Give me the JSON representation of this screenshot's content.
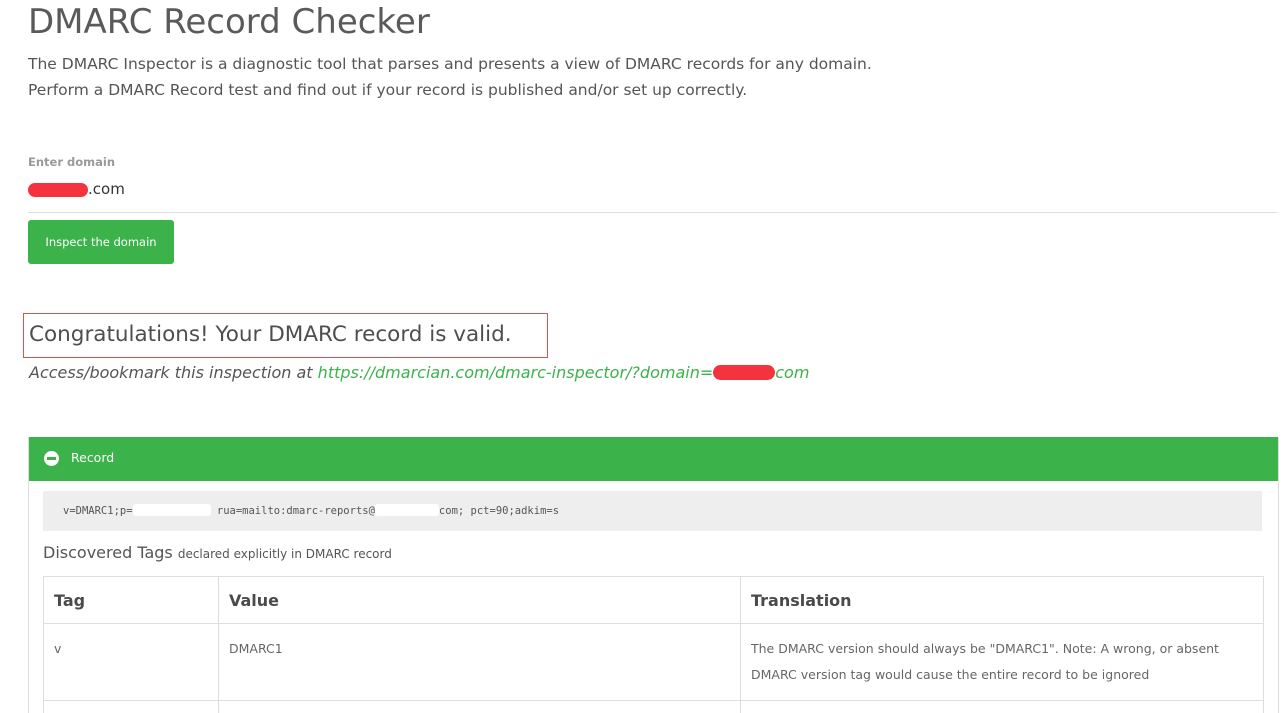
{
  "header": {
    "title": "DMARC Record Checker",
    "description_line1": "The DMARC Inspector is a diagnostic tool that parses and presents a view of DMARC records for any domain.",
    "description_line2": "Perform a DMARC Record test and find out if your record is published and/or set up correctly."
  },
  "form": {
    "domain_label": "Enter domain",
    "domain_value_visible": ".com",
    "inspect_button_label": "Inspect the domain"
  },
  "result": {
    "congrats_text": "Congratulations! Your DMARC record is valid.",
    "access_prefix": "Access/bookmark this inspection at ",
    "access_link_text": "https://dmarcian.com/dmarc-inspector/?domain=",
    "access_link_suffix": "com"
  },
  "record_panel": {
    "title": "Record",
    "record_part1": "v=DMARC1;p=",
    "record_part2": "rua=mailto:dmarc-reports@",
    "record_part3": "com; pct=90;adkim=s"
  },
  "discovered": {
    "heading": "Discovered Tags",
    "subheading": "declared explicitly in DMARC record"
  },
  "table": {
    "headers": [
      "Tag",
      "Value",
      "Translation"
    ],
    "rows": [
      {
        "tag": "v",
        "value": "DMARC1",
        "translation": "The DMARC version should always be \"DMARC1\". Note: A wrong, or absent DMARC version tag would cause the entire record to be ignored"
      }
    ]
  },
  "colors": {
    "brand_green": "#3bb34a",
    "highlight_border": "#d9534f",
    "redaction": "#f5333f"
  },
  "icons": {
    "collapse": "minus-circle-icon"
  }
}
